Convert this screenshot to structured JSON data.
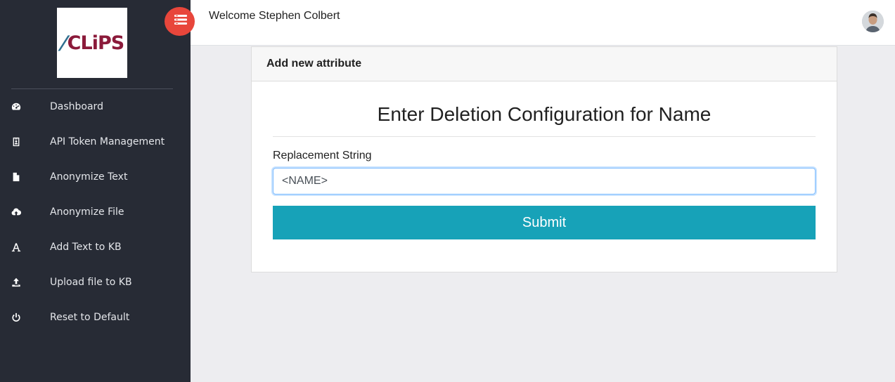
{
  "sidebar": {
    "logo_text": "CLiPS",
    "items": [
      {
        "label": "Dashboard",
        "icon": "dashboard-icon"
      },
      {
        "label": "API Token Management",
        "icon": "id-badge-icon"
      },
      {
        "label": "Anonymize Text",
        "icon": "file-text-icon"
      },
      {
        "label": "Anonymize File",
        "icon": "cloud-upload-icon"
      },
      {
        "label": "Add Text to KB",
        "icon": "font-icon"
      },
      {
        "label": "Upload file to KB",
        "icon": "upload-icon"
      },
      {
        "label": "Reset to Default",
        "icon": "power-icon"
      }
    ]
  },
  "topbar": {
    "welcome": "Welcome Stephen Colbert",
    "toggle_icon": "menu-toggle-icon",
    "avatar_icon": "user-avatar-icon"
  },
  "card": {
    "header": "Add new attribute",
    "heading": "Enter Deletion Configuration for Name",
    "field_label": "Replacement String",
    "input_value": "<NAME>",
    "submit_label": "Submit"
  },
  "colors": {
    "sidebar_bg": "#272b35",
    "toggle_accent": "#e8463b",
    "submit_bg": "#17a2b8",
    "logo_text": "#8b1a3a"
  }
}
